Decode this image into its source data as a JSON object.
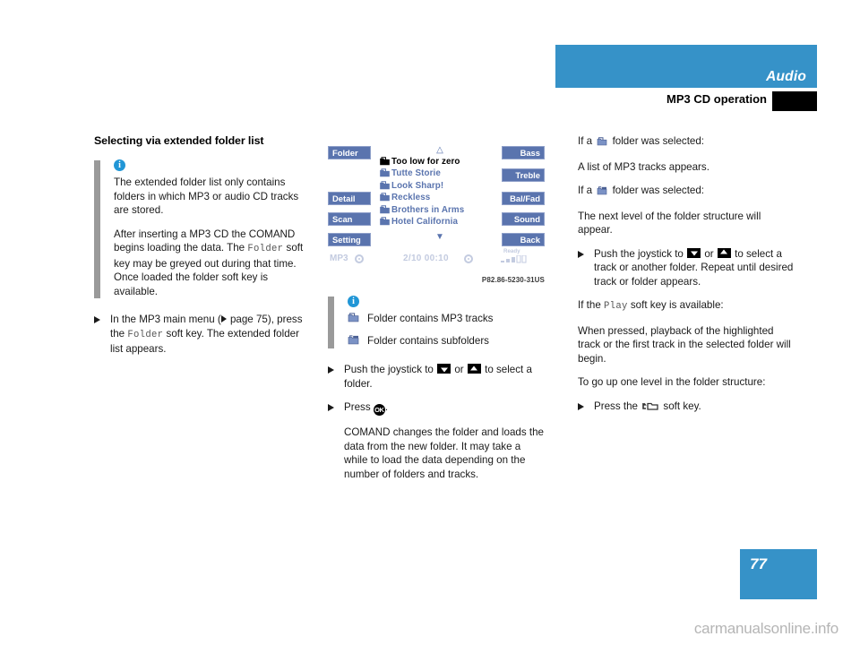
{
  "header": {
    "banner_title": "Audio",
    "subtitle": "MP3 CD operation",
    "banner_color": "#3692c8"
  },
  "left_column": {
    "section_title": "Selecting via extended folder list",
    "note": {
      "icon": "info-icon",
      "paragraph_1": "The extended folder list only contains folders in which MP3 or audio CD tracks are stored.",
      "paragraph_2_part_1": "After inserting a MP3 CD the COMAND begins loading the data. The ",
      "paragraph_2_mono": "Folder",
      "paragraph_2_part_2": " soft key may be greyed out during that time. Once loaded the folder soft key is available."
    },
    "step": {
      "text_part_1": "In the MP3 main menu (",
      "page_ref": " page 75),  press the ",
      "mono": "Folder",
      "text_part_2": " soft key. The extended folder list appears."
    }
  },
  "device": {
    "soft_keys_left": [
      "Folder",
      "Detail",
      "Scan",
      "Setting"
    ],
    "soft_keys_right": [
      "Bass",
      "Treble",
      "Bal/Fad",
      "Sound",
      "Back"
    ],
    "scroll_up_glyph": "△",
    "scroll_down_glyph": "▼",
    "list": [
      {
        "label": "Too low for zero",
        "selected": true
      },
      {
        "label": "Tutte Storie",
        "selected": false
      },
      {
        "label": "Look Sharp!",
        "selected": false
      },
      {
        "label": "Reckless",
        "selected": false
      },
      {
        "label": "Brothers in Arms",
        "selected": false
      },
      {
        "label": "Hotel California",
        "selected": false
      }
    ],
    "status": {
      "source": "MP3",
      "track": "2/10  00:10",
      "ready": "Ready"
    },
    "caption": "P82.86-5230-31US"
  },
  "mid_column": {
    "legend": {
      "icon": "info-icon",
      "rows": [
        {
          "icon": "folder-mp3-icon",
          "label": "Folder contains MP3 tracks"
        },
        {
          "icon": "folder-subfolder-icon",
          "label": "Folder contains subfolders"
        }
      ]
    },
    "step_1": {
      "text_part_1": "Push the joystick to ",
      "text_or": " or ",
      "text_part_2": " to select a folder."
    },
    "step_2": {
      "text": "Press "
    },
    "paragraph": "COMAND changes the folder and loads the data from the new folder. It may take a while to load the data depending on the number of folders and tracks."
  },
  "right_column": {
    "line_1_prefix": "If a ",
    "line_1_suffix": " folder was selected:",
    "line_2": "A list of MP3 tracks appears.",
    "line_3_prefix": "If a ",
    "line_3_suffix": " folder was selected:",
    "line_4": "The next level of the folder structure will appear.",
    "step_1": {
      "text_part_1": "Push the joystick to ",
      "text_or": " or ",
      "text_part_2": " to select a track or another folder. Repeat until desired track or folder appears."
    },
    "line_5_prefix": "If the ",
    "line_5_mono": "Play",
    "line_5_suffix": " soft key is available:",
    "line_6": "When pressed, playback of the highlighted track or the first track in the selected folder will begin.",
    "line_7": "To go up one level in the folder structure:",
    "step_2": {
      "text_part_1": "Press the ",
      "text_part_2": " soft key."
    }
  },
  "footer": {
    "page_number": "77",
    "watermark": "carmanualsonline.info"
  }
}
